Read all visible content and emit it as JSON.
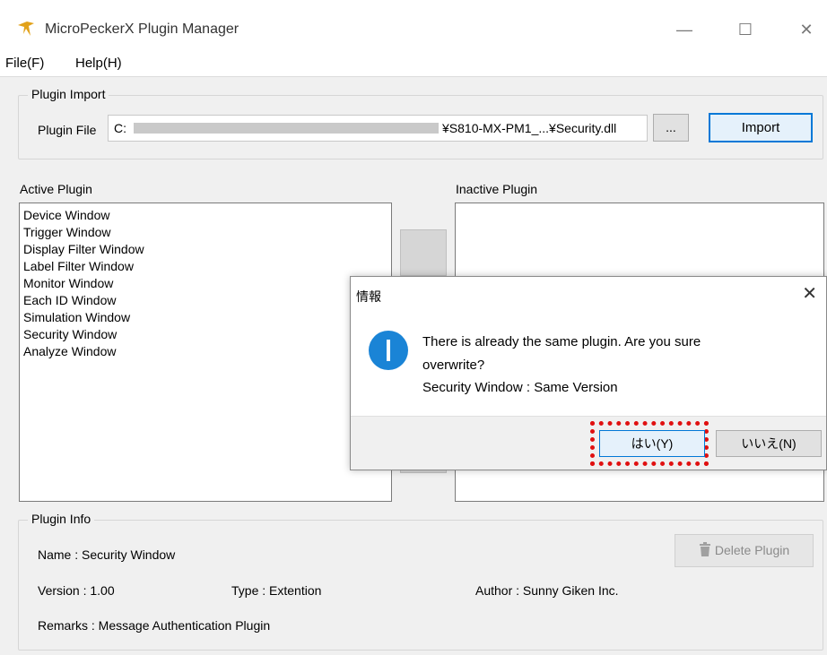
{
  "window": {
    "title": "MicroPeckerX Plugin Manager",
    "controls": {
      "minimize": "—",
      "maximize": "☐",
      "close": "✕"
    }
  },
  "menu": {
    "items": [
      "File(F)",
      "Help(H)"
    ]
  },
  "plugin_import": {
    "group_title": "Plugin Import",
    "file_label": "Plugin File",
    "file_value_prefix": "C:",
    "file_value_suffix": "¥S810-MX-PM1_...¥Security.dll",
    "browse_label": "...",
    "import_label": "Import"
  },
  "active_plugin": {
    "label": "Active Plugin",
    "items": [
      "Device Window",
      "Trigger Window",
      "Display Filter Window",
      "Label Filter Window",
      "Monitor Window",
      "Each ID Window",
      "Simulation Window",
      "Security Window",
      "Analyze Window"
    ]
  },
  "inactive_plugin": {
    "label": "Inactive Plugin",
    "items": []
  },
  "plugin_info": {
    "group_title": "Plugin Info",
    "name": "Name : Security Window",
    "version": "Version : 1.00",
    "type": "Type : Extention",
    "author": "Author : Sunny Giken Inc.",
    "remarks": "Remarks : Message Authentication Plugin",
    "delete_label": "Delete Plugin"
  },
  "dialog": {
    "title": "情報",
    "close": "✕",
    "message_line1": "There is already the same plugin. Are you sure",
    "message_line2": "overwrite?",
    "message_line3": "Security Window : Same Version",
    "yes_label": "はい(Y)",
    "no_label": "いいえ(N)",
    "icon": "info-icon"
  },
  "colors": {
    "accent": "#0078d7",
    "info_icon": "#1a84d6",
    "highlight": "#e01010"
  }
}
